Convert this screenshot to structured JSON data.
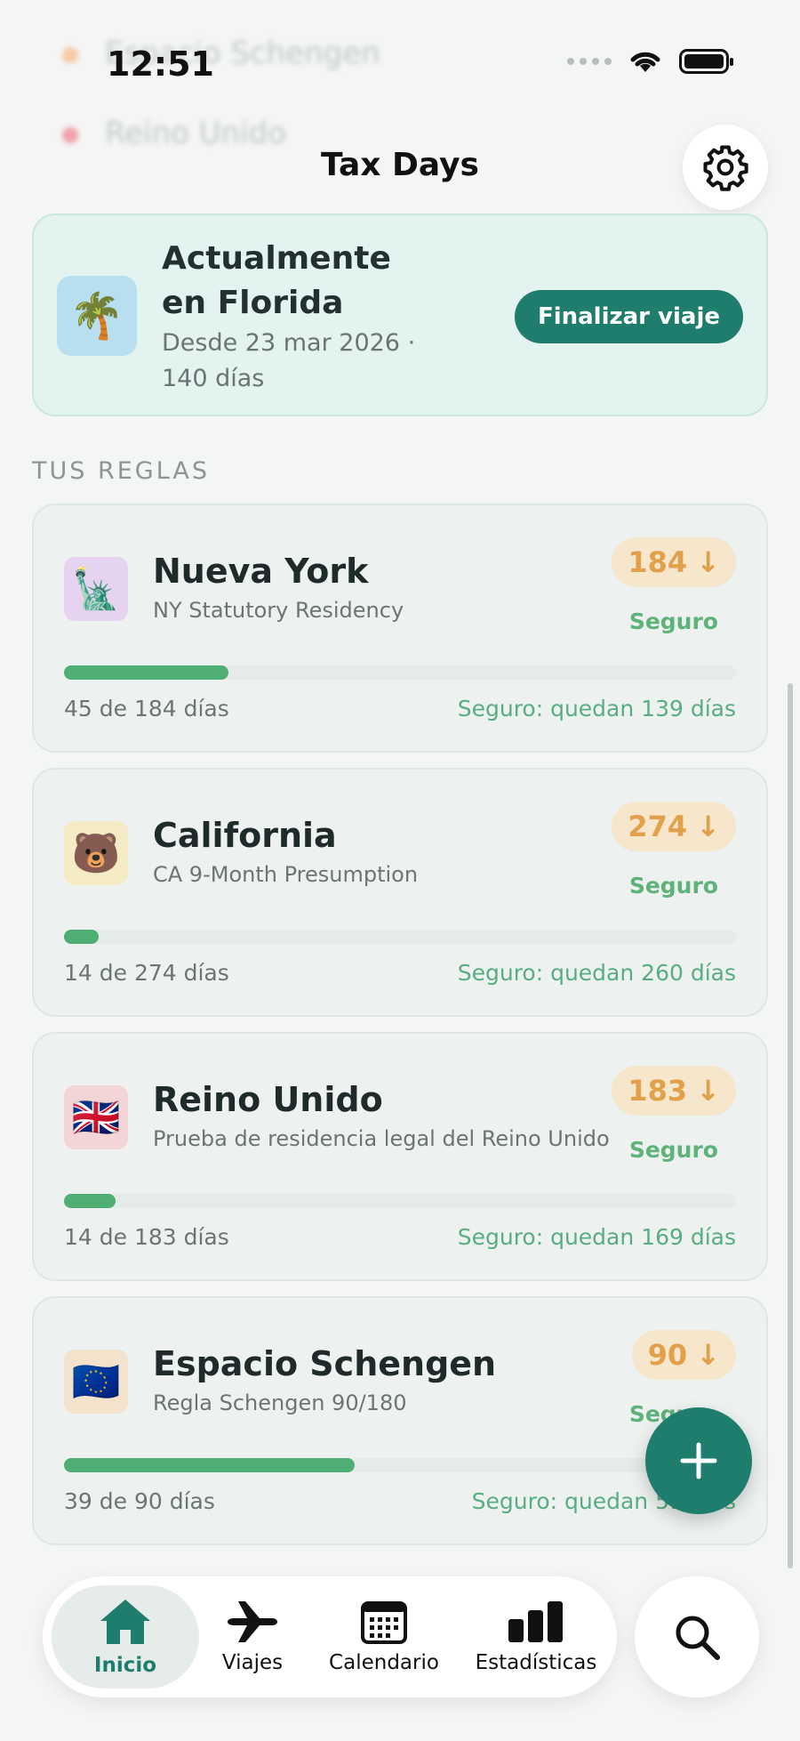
{
  "status_bar": {
    "time": "12:51"
  },
  "background_ghost": {
    "row1": "Espacio Schengen",
    "row2": "Reino Unido"
  },
  "header": {
    "title": "Tax Days",
    "settings_icon": "gear-icon"
  },
  "current_location": {
    "title": "Actualmente en Florida",
    "subtitle": "Desde 23 mar 2026 · 140 días",
    "icon": "🌴",
    "end_trip_label": "Finalizar viaje"
  },
  "rules_section": {
    "label": "TUS REGLAS"
  },
  "rules": [
    {
      "name": "Nueva York",
      "description": "NY Statutory Residency",
      "icon": "🗽",
      "icon_bg": "#e6d3ef",
      "limit": "184",
      "limit_arrow": "↓",
      "status": "Seguro",
      "progress": 0.245,
      "count": "45 de 184 días",
      "safe_text": "Seguro: quedan 139 días"
    },
    {
      "name": "California",
      "description": "CA 9-Month Presumption",
      "icon": "🐻",
      "icon_bg": "#f5ecc6",
      "limit": "274",
      "limit_arrow": "↓",
      "status": "Seguro",
      "progress": 0.051,
      "count": "14 de 274 días",
      "safe_text": "Seguro: quedan 260 días"
    },
    {
      "name": "Reino Unido",
      "description": "Prueba de residencia legal del Reino Unido",
      "icon": "🇬🇧",
      "icon_bg": "#f3d4d7",
      "limit": "183",
      "limit_arrow": "↓",
      "status": "Seguro",
      "progress": 0.077,
      "count": "14 de 183 días",
      "safe_text": "Seguro: quedan 169 días"
    },
    {
      "name": "Espacio Schengen",
      "description": "Regla Schengen 90/180",
      "icon": "🇪🇺",
      "icon_bg": "#f3e2cc",
      "limit": "90",
      "limit_arrow": "↓",
      "status": "Seguro",
      "progress": 0.433,
      "count": "39 de 90 días",
      "safe_text": "Seguro: quedan 51 días"
    }
  ],
  "fab": {
    "icon": "plus-icon"
  },
  "tabbar": {
    "tabs": [
      {
        "label": "Inicio",
        "icon": "home-icon",
        "active": true
      },
      {
        "label": "Viajes",
        "icon": "airplane-icon",
        "active": false
      },
      {
        "label": "Calendario",
        "icon": "calendar-icon",
        "active": false
      },
      {
        "label": "Estadísticas",
        "icon": "bar-chart-icon",
        "active": false
      }
    ],
    "search_icon": "search-icon"
  },
  "colors": {
    "accent": "#1f7d6d",
    "safe_green": "#4fae74",
    "limit_orange": "#e2a04a",
    "current_card_bg": "#e3f3ef"
  }
}
